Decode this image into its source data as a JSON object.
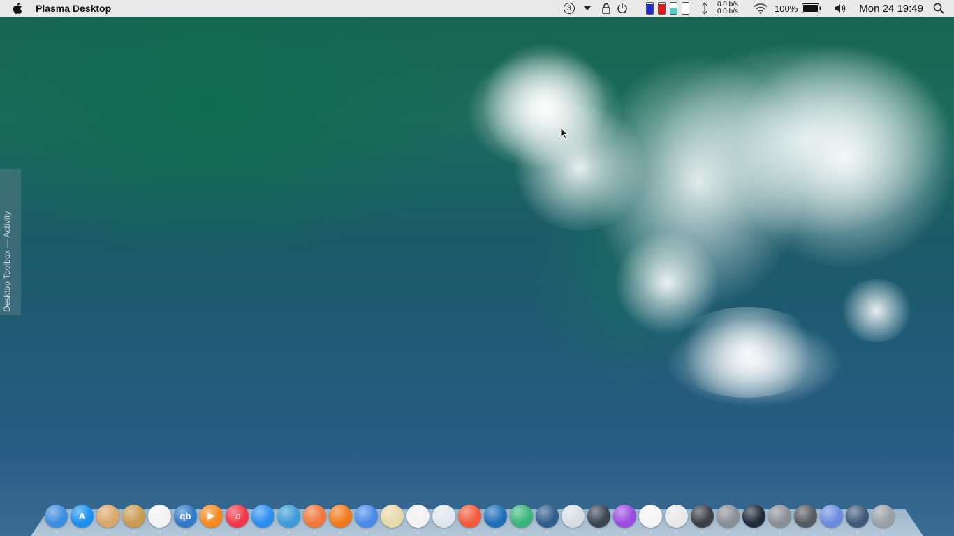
{
  "menubar": {
    "app_title": "Plasma Desktop",
    "badge": "3",
    "net_up": "0.0 b/s",
    "net_down": "0.0 b/s",
    "battery_percent": "100%",
    "battery_level": 1.0,
    "clock": "Mon 24  19:49"
  },
  "monitors": [
    {
      "name": "cpu",
      "fill": 0.85,
      "color": "#1d2bd1"
    },
    {
      "name": "memory",
      "fill": 0.9,
      "color": "#e31818"
    },
    {
      "name": "swap",
      "fill": 0.55,
      "color": "#4fd1c8"
    },
    {
      "name": "disk",
      "fill": 0.0,
      "color": "#ffffff"
    }
  ],
  "toolbox": {
    "label": "Desktop Toolbox — Activity"
  },
  "dock": {
    "items": [
      {
        "name": "finder",
        "color": "#3b8de0",
        "glyph": ""
      },
      {
        "name": "app-store",
        "color": "#1b8ff0",
        "glyph": "A"
      },
      {
        "name": "notes",
        "color": "#d9a76a",
        "glyph": ""
      },
      {
        "name": "contacts",
        "color": "#c99a4f",
        "glyph": ""
      },
      {
        "name": "phone",
        "color": "#f2f2f2",
        "glyph": ""
      },
      {
        "name": "qbittorrent",
        "color": "#2f79c6",
        "glyph": "qb"
      },
      {
        "name": "media-player",
        "color": "#f68a1e",
        "glyph": "▶"
      },
      {
        "name": "music",
        "color": "#f2384a",
        "glyph": "♫"
      },
      {
        "name": "messenger",
        "color": "#2a8ef0",
        "glyph": ""
      },
      {
        "name": "telegram",
        "color": "#3d9bd8",
        "glyph": ""
      },
      {
        "name": "rss-reader",
        "color": "#f2773a",
        "glyph": ""
      },
      {
        "name": "firefox",
        "color": "#f07a1a",
        "glyph": ""
      },
      {
        "name": "chrome",
        "color": "#4a8ae8",
        "glyph": ""
      },
      {
        "name": "image-viewer",
        "color": "#e8d9a8",
        "glyph": ""
      },
      {
        "name": "charts",
        "color": "#f2f2f2",
        "glyph": ""
      },
      {
        "name": "scanner",
        "color": "#dfe6ee",
        "glyph": ""
      },
      {
        "name": "pen-app",
        "color": "#f25a3a",
        "glyph": ""
      },
      {
        "name": "vscode",
        "color": "#1e6fb8",
        "glyph": ""
      },
      {
        "name": "atom",
        "color": "#3ab57a",
        "glyph": ""
      },
      {
        "name": "kdeconnect",
        "color": "#2f5c8a",
        "glyph": ""
      },
      {
        "name": "webcam",
        "color": "#d6dde4",
        "glyph": ""
      },
      {
        "name": "lens-app",
        "color": "#3a4452",
        "glyph": ""
      },
      {
        "name": "paint",
        "color": "#9b4ce0",
        "glyph": ""
      },
      {
        "name": "photos",
        "color": "#f5f5f5",
        "glyph": ""
      },
      {
        "name": "disk-usage",
        "color": "#e8e8e8",
        "glyph": ""
      },
      {
        "name": "terminal",
        "color": "#3a3f46",
        "glyph": ""
      },
      {
        "name": "settings-a",
        "color": "#8a8f96",
        "glyph": ""
      },
      {
        "name": "speedometer",
        "color": "#1f2a3a",
        "glyph": ""
      },
      {
        "name": "settings-b",
        "color": "#8a8f96",
        "glyph": ""
      },
      {
        "name": "trash",
        "color": "#555a60",
        "glyph": ""
      },
      {
        "name": "folder-blue",
        "color": "#6c8be0",
        "glyph": ""
      },
      {
        "name": "screen-share",
        "color": "#3e5a78",
        "glyph": ""
      },
      {
        "name": "system-preferences",
        "color": "#9aa0a6",
        "glyph": ""
      }
    ]
  }
}
